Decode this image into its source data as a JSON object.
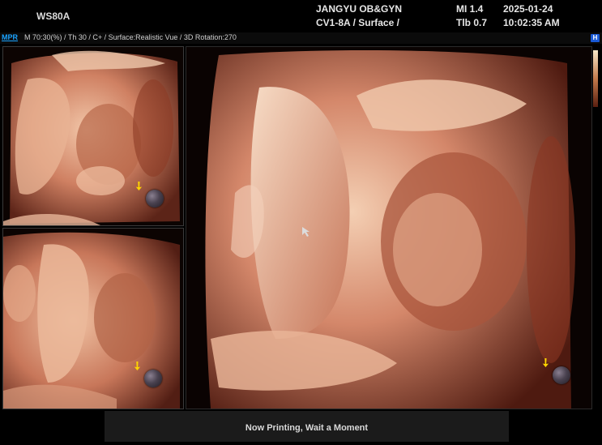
{
  "header": {
    "device": "WS80A",
    "hospital": "JANGYU OB&GYN",
    "probe_mode": "CV1-8A / Surface /",
    "mi": "MI  1.4",
    "tib": "Tlb 0.7",
    "date": "2025-01-24",
    "time": "10:02:35 AM"
  },
  "info_bar": {
    "mode": "MPR",
    "params": "M 70:30(%) / Th 30 / C+ / Surface:Realistic Vue / 3D Rotation:270",
    "badge": "H"
  },
  "status": {
    "message": "Now Printing, Wait a Moment"
  },
  "colors": {
    "skin_light": "#f0c4a6",
    "skin_mid": "#c9785a",
    "skin_dark": "#6a2a1a",
    "marker_arrow": "#ffd400",
    "mpr_blue": "#1aa3ff"
  }
}
